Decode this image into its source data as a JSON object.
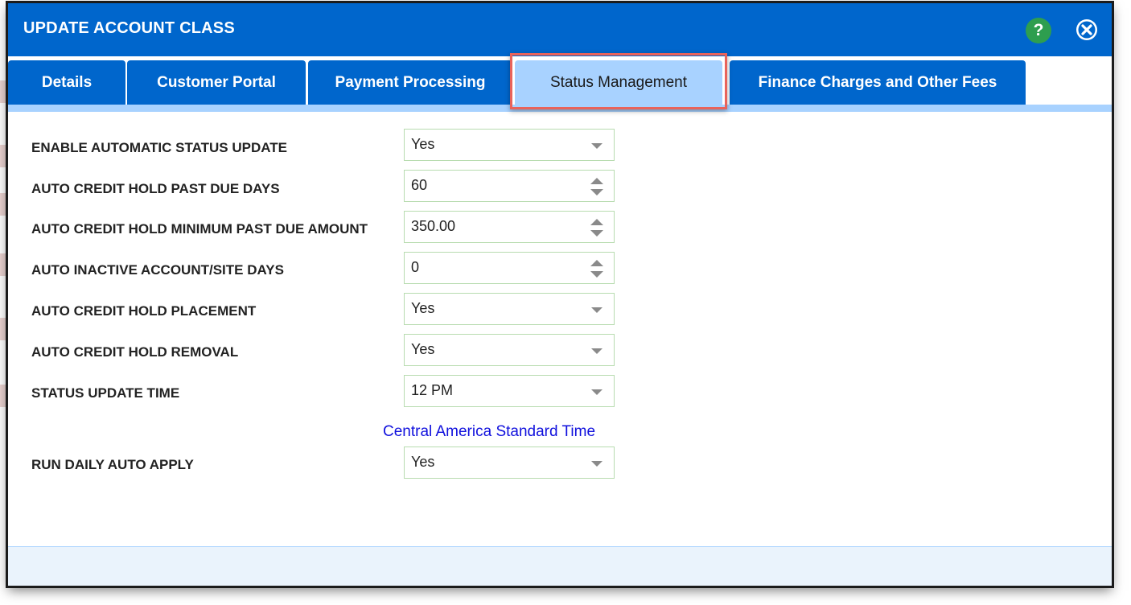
{
  "dialog": {
    "title": "UPDATE ACCOUNT CLASS",
    "help_label": "?",
    "colors": {
      "header": "#0066cc",
      "active_tab": "#a8d2ff",
      "highlight": "#e8635b",
      "link": "#1010dd"
    }
  },
  "tabs": [
    {
      "label": "Details"
    },
    {
      "label": "Customer Portal"
    },
    {
      "label": "Payment Processing"
    },
    {
      "label": "Status Management"
    },
    {
      "label": "Finance Charges and Other Fees"
    }
  ],
  "active_tab": "Status Management",
  "form": {
    "enable_auto_status": {
      "label": "ENABLE AUTOMATIC STATUS UPDATE",
      "value": "Yes"
    },
    "past_due_days": {
      "label": "AUTO CREDIT HOLD PAST DUE DAYS",
      "value": "60"
    },
    "min_past_due_amount": {
      "label": "AUTO CREDIT HOLD MINIMUM PAST DUE AMOUNT",
      "value": "350.00"
    },
    "inactive_days": {
      "label": "AUTO INACTIVE ACCOUNT/SITE DAYS",
      "value": "0"
    },
    "hold_placement": {
      "label": "AUTO CREDIT HOLD PLACEMENT",
      "value": "Yes"
    },
    "hold_removal": {
      "label": "AUTO CREDIT HOLD REMOVAL",
      "value": "Yes"
    },
    "update_time": {
      "label": "STATUS UPDATE TIME",
      "value": "12 PM"
    },
    "timezone_link": "Central America Standard Time",
    "daily_auto_apply": {
      "label": "RUN DAILY AUTO APPLY",
      "value": "Yes"
    }
  }
}
